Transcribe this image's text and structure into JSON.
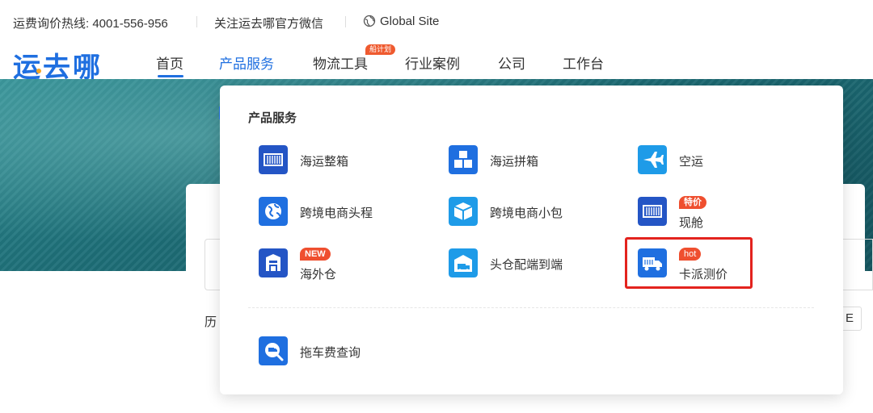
{
  "topbar": {
    "hotline": "运费询价热线: 4001-556-956",
    "wechat": "关注运去哪官方微信",
    "global_site": "Global Site"
  },
  "logo": {
    "text": "运去哪"
  },
  "nav": {
    "items": [
      "首页",
      "产品服务",
      "物流工具",
      "行业案例",
      "公司",
      "工作台"
    ],
    "active_index": 1,
    "tools_badge": "船计划"
  },
  "colors": {
    "brand": "#1f6fe0",
    "tag": "#ef4f2f",
    "highlight": "#e3231e"
  },
  "dropdown": {
    "title": "产品服务",
    "items": [
      {
        "label": "海运整箱",
        "icon": "container-icon",
        "tag": ""
      },
      {
        "label": "海运拼箱",
        "icon": "boxes-icon",
        "tag": ""
      },
      {
        "label": "空运",
        "icon": "airplane-icon",
        "tag": ""
      },
      {
        "label": "跨境电商头程",
        "icon": "globe-icon",
        "tag": ""
      },
      {
        "label": "跨境电商小包",
        "icon": "parcel-icon",
        "tag": ""
      },
      {
        "label": "现舱",
        "icon": "container-icon",
        "tag": "特价"
      },
      {
        "label": "海外仓",
        "icon": "warehouse-icon",
        "tag": "NEW"
      },
      {
        "label": "头仓配端到端",
        "icon": "warehouse-truck-icon",
        "tag": ""
      },
      {
        "label": "卡派测价",
        "icon": "truck-icon",
        "tag": "hot"
      },
      {
        "label": "拖车费查询",
        "icon": "search-truck-icon",
        "tag": ""
      }
    ]
  },
  "background": {
    "history_fragment": "历",
    "chip_fragment": "E"
  }
}
